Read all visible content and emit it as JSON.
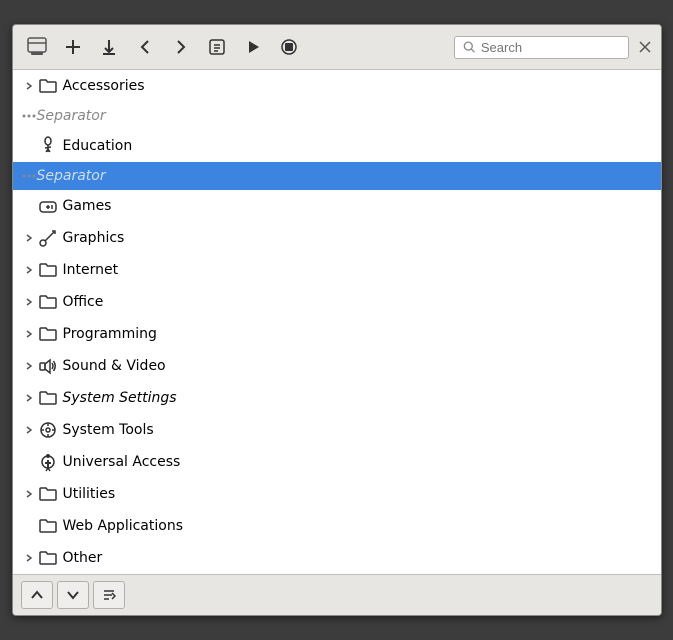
{
  "toolbar": {
    "add_label": "+",
    "download_label": "⬇",
    "back_label": "←",
    "forward_label": "→",
    "info_label": "🗒",
    "play_label": "▶",
    "stop_label": "⊗",
    "close_label": "✕",
    "search_placeholder": "Search"
  },
  "items": [
    {
      "id": "accessories",
      "type": "folder",
      "label": "Accessories",
      "hasArrow": true,
      "icon": "folder",
      "selected": false
    },
    {
      "id": "sep1",
      "type": "separator",
      "label": "Separator",
      "hasArrow": false,
      "icon": "ellipsis",
      "selected": false
    },
    {
      "id": "education",
      "type": "folder",
      "label": "Education",
      "hasArrow": false,
      "icon": "edu",
      "selected": false
    },
    {
      "id": "sep2",
      "type": "separator",
      "label": "Separator",
      "hasArrow": false,
      "icon": "ellipsis",
      "selected": true
    },
    {
      "id": "games",
      "type": "item",
      "label": "Games",
      "hasArrow": false,
      "icon": "games",
      "selected": false
    },
    {
      "id": "graphics",
      "type": "folder",
      "label": "Graphics",
      "hasArrow": true,
      "icon": "graphics",
      "selected": false
    },
    {
      "id": "internet",
      "type": "folder",
      "label": "Internet",
      "hasArrow": true,
      "icon": "folder",
      "selected": false
    },
    {
      "id": "office",
      "type": "folder",
      "label": "Office",
      "hasArrow": true,
      "icon": "folder",
      "selected": false
    },
    {
      "id": "programming",
      "type": "folder",
      "label": "Programming",
      "hasArrow": true,
      "icon": "folder",
      "selected": false
    },
    {
      "id": "sound",
      "type": "folder",
      "label": "Sound & Video",
      "hasArrow": true,
      "icon": "sound",
      "selected": false
    },
    {
      "id": "sysset",
      "type": "folder",
      "label": "System Settings",
      "hasArrow": true,
      "icon": "folder",
      "selected": false,
      "italic": true
    },
    {
      "id": "systools",
      "type": "folder",
      "label": "System Tools",
      "hasArrow": true,
      "icon": "tools",
      "selected": false
    },
    {
      "id": "access",
      "type": "item",
      "label": "Universal Access",
      "hasArrow": false,
      "icon": "access",
      "selected": false
    },
    {
      "id": "utilities",
      "type": "folder",
      "label": "Utilities",
      "hasArrow": true,
      "icon": "folder",
      "selected": false
    },
    {
      "id": "webapps",
      "type": "folder",
      "label": "Web Applications",
      "hasArrow": false,
      "icon": "folder",
      "selected": false
    },
    {
      "id": "other",
      "type": "folder",
      "label": "Other",
      "hasArrow": true,
      "icon": "folder",
      "selected": false
    }
  ],
  "statusbar": {
    "up_label": "▲",
    "down_label": "▼",
    "sort_label": "≡"
  }
}
